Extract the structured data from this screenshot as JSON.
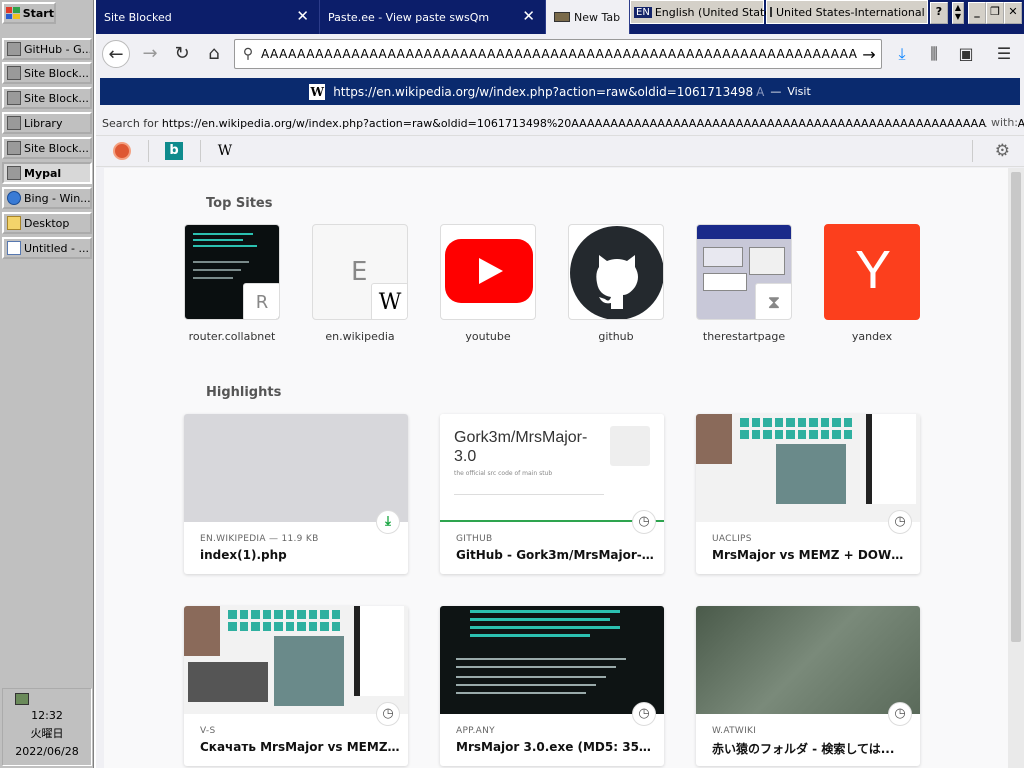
{
  "taskbar": {
    "start_label": "Start",
    "items": [
      {
        "label": "GitHub - G..."
      },
      {
        "label": "Site Block..."
      },
      {
        "label": "Site Block..."
      },
      {
        "label": "Library"
      },
      {
        "label": "Site Block..."
      },
      {
        "label": "Mypal"
      },
      {
        "label": "Bing - Win..."
      },
      {
        "label": "Desktop"
      },
      {
        "label": "Untitled - ..."
      }
    ],
    "clock": {
      "time": "12:32",
      "day": "火曜日",
      "date": "2022/06/28"
    }
  },
  "tabs": [
    {
      "title": "Site Blocked"
    },
    {
      "title": "Paste.ee - View paste swsQm"
    },
    {
      "title": "New Tab"
    }
  ],
  "system_bar": {
    "lang_code": "EN",
    "lang_name": "English (United States)",
    "keyboard": "United States-International",
    "help": "?"
  },
  "address": {
    "value": "AAAAAAAAAAAAAAAAAAAAAAAAAAAAAAAAAAAAAAAAAAAAAAAAAAAAAAAAAAAAAAAAAAAAAAAAAAAAAAAA"
  },
  "suggestion": {
    "url": "https://en.wikipedia.org/w/index.php?action=raw&oldid=1061713498",
    "tail": "A",
    "separator": "—",
    "action": "Visit"
  },
  "search_for": {
    "prefix": "Search for",
    "query": "https://en.wikipedia.org/w/index.php?action=raw&oldid=1061713498%20AAAAAAAAAAAAAAAAAAAAAAAAAAAAAAAAAAAAAAAAAAAAAAAAAAAAAAAAAAAAAAAAAAAAAAAAAAA...",
    "suffix": "with:"
  },
  "engines": {
    "bing": "b",
    "wiki": "W"
  },
  "top_sites": {
    "heading": "Top Sites",
    "items": [
      {
        "label": "router.collabnet",
        "badge": "R"
      },
      {
        "label": "en.wikipedia",
        "letter": "E",
        "badge": "W"
      },
      {
        "label": "youtube"
      },
      {
        "label": "github"
      },
      {
        "label": "therestartpage"
      },
      {
        "label": "yandex",
        "letter": "Y"
      }
    ]
  },
  "highlights": {
    "heading": "Highlights",
    "cards": [
      {
        "meta": "EN.WIKIPEDIA — 11.9 KB",
        "title": "index(1).php"
      },
      {
        "meta": "GITHUB",
        "title": "GitHub - Gork3m/MrsMajor-3.0:...",
        "preview_title": "Gork3m/MrsMajor-3.0",
        "preview_sub": "the official src code of main stub"
      },
      {
        "meta": "UACLIPS",
        "title": "MrsMajor vs MEMZ + DOWNLO..."
      },
      {
        "meta": "V-S",
        "title": "Скачать MrsMajor vs MEMZ + D..."
      },
      {
        "meta": "APP.ANY",
        "title": "MrsMajor 3.0.exe (MD5: 35A27..."
      },
      {
        "meta": "W.ATWIKI",
        "title": "赤い猿のフォルダ - 検索しては..."
      }
    ]
  },
  "colors": {
    "tabbar": "#0c1e6a",
    "suggest": "#0a2a6e",
    "youtube": "#ff0000",
    "yandex": "#fc3f1d",
    "github": "#24292e",
    "accent": "#0060df"
  }
}
